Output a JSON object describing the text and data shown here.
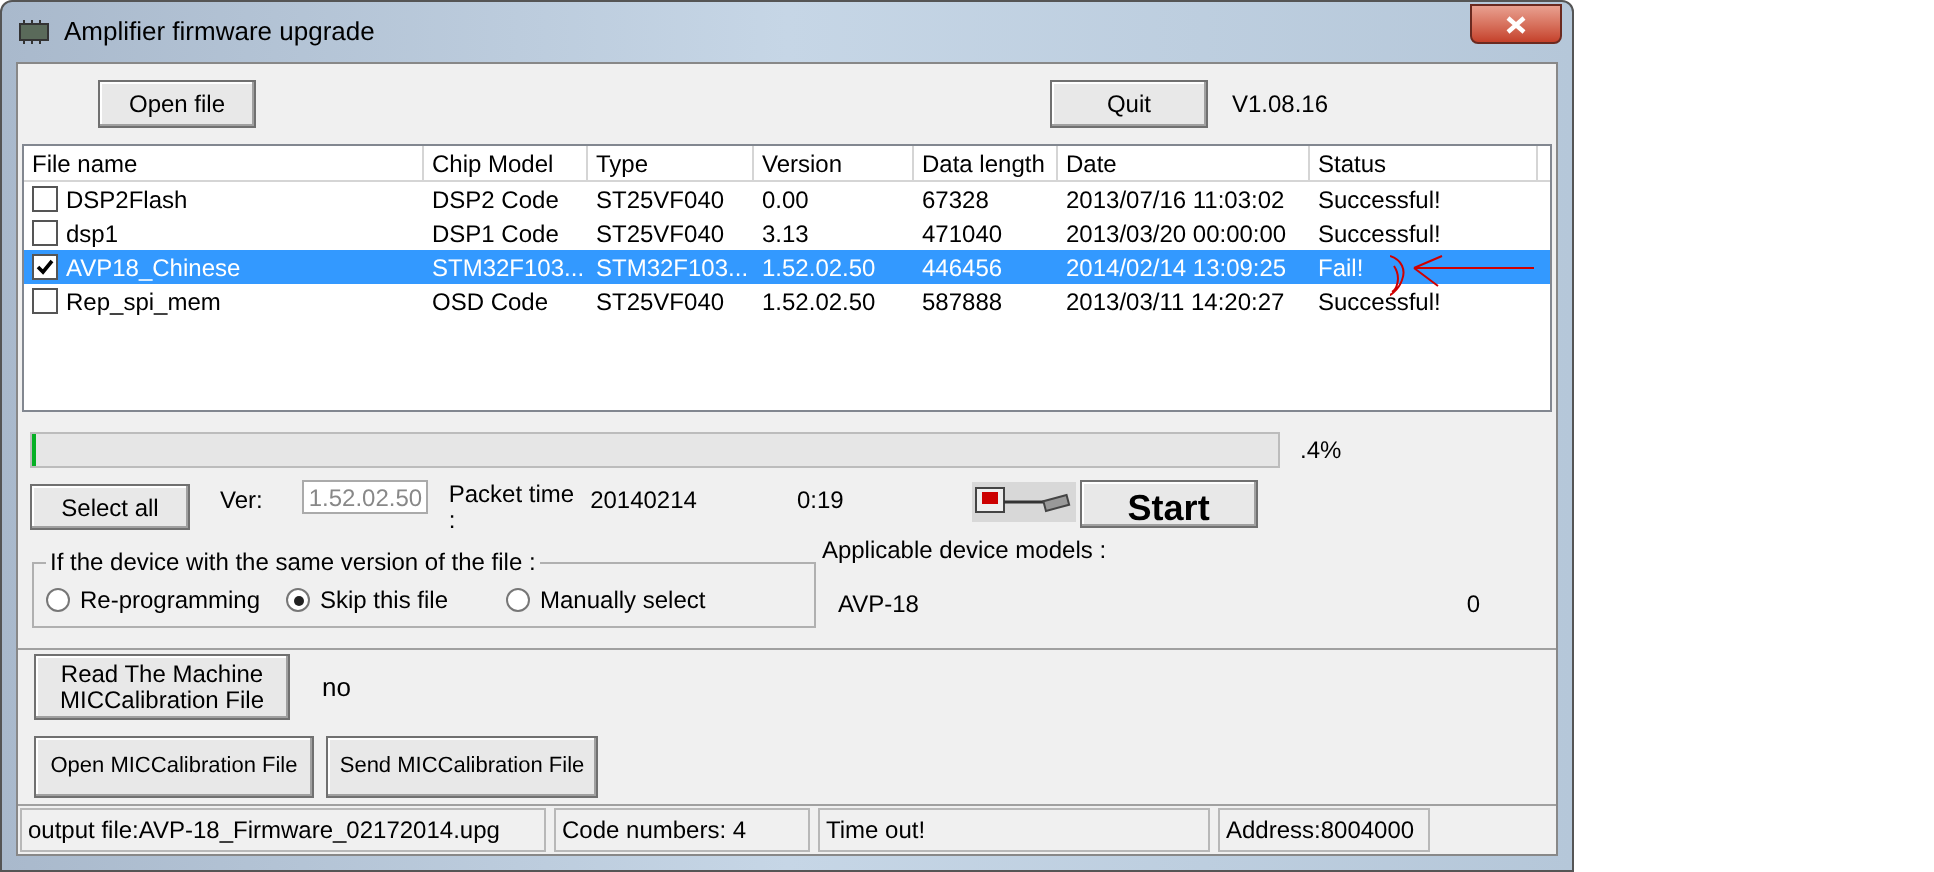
{
  "window": {
    "title": "Amplifier firmware upgrade"
  },
  "toolbar": {
    "open_button": "Open file",
    "quit_button": "Quit",
    "version": "V1.08.16"
  },
  "table": {
    "columns": [
      "File name",
      "Chip Model",
      "Type",
      "Version",
      "Data length",
      "Date",
      "Status"
    ],
    "rows": [
      {
        "checked": false,
        "selected": false,
        "cells": [
          "DSP2Flash",
          "DSP2 Code",
          "ST25VF040",
          "0.00",
          "67328",
          "2013/07/16 11:03:02",
          "Successful!"
        ]
      },
      {
        "checked": false,
        "selected": false,
        "cells": [
          "dsp1",
          "DSP1 Code",
          "ST25VF040",
          "3.13",
          "471040",
          "2013/03/20 00:00:00",
          "Successful!"
        ]
      },
      {
        "checked": true,
        "selected": true,
        "cells": [
          "AVP18_Chinese",
          "STM32F103...",
          "STM32F103...",
          "1.52.02.50",
          "446456",
          "2014/02/14 13:09:25",
          "Fail!"
        ]
      },
      {
        "checked": false,
        "selected": false,
        "cells": [
          "Rep_spi_mem",
          "OSD Code",
          "ST25VF040",
          "1.52.02.50",
          "587888",
          "2013/03/11 14:20:27",
          "Successful!"
        ]
      }
    ]
  },
  "progress": {
    "level": 0.004,
    "reading": ".4%"
  },
  "controls": {
    "select_all": "Select all",
    "ver_label": "Ver:",
    "ver_value": "1.52.02.50",
    "packet_label": "Packet time\n:",
    "packet_value": "20140214",
    "timer": "0:19",
    "start": "Start"
  },
  "same_version": {
    "legend": "If the device with the same version of the file :",
    "options": [
      {
        "label": "Re-programming",
        "selected": false
      },
      {
        "label": "Skip this file",
        "selected": true
      },
      {
        "label": "Manually select",
        "selected": false
      }
    ]
  },
  "devices": {
    "label": "Applicable device models :",
    "model": "AVP-18",
    "count": "0"
  },
  "calibration": {
    "read_button": "Read The Machine\nMICCalibration File",
    "read_result": "no",
    "open_button": "Open MICCalibration File",
    "send_button": "Send MICCalibration File"
  },
  "status_bar": [
    "output file:AVP-18_Firmware_02172014.upg",
    "Code numbers: 4",
    "Time out!",
    "Address:8004000"
  ]
}
